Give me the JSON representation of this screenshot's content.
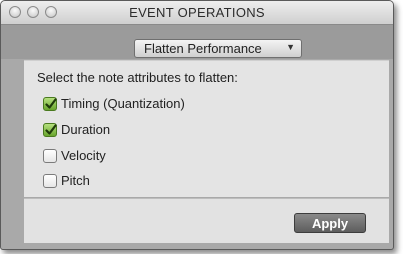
{
  "window": {
    "title": "EVENT OPERATIONS"
  },
  "toolbar": {
    "selected_operation": "Flatten Performance"
  },
  "panel": {
    "instruction": "Select the note attributes to flatten:",
    "options": [
      {
        "label": "Timing (Quantization)",
        "checked": true
      },
      {
        "label": "Duration",
        "checked": true
      },
      {
        "label": "Velocity",
        "checked": false
      },
      {
        "label": "Pitch",
        "checked": false
      }
    ]
  },
  "footer": {
    "apply_label": "Apply"
  },
  "colors": {
    "checkbox_checked": "#6aa82e"
  }
}
